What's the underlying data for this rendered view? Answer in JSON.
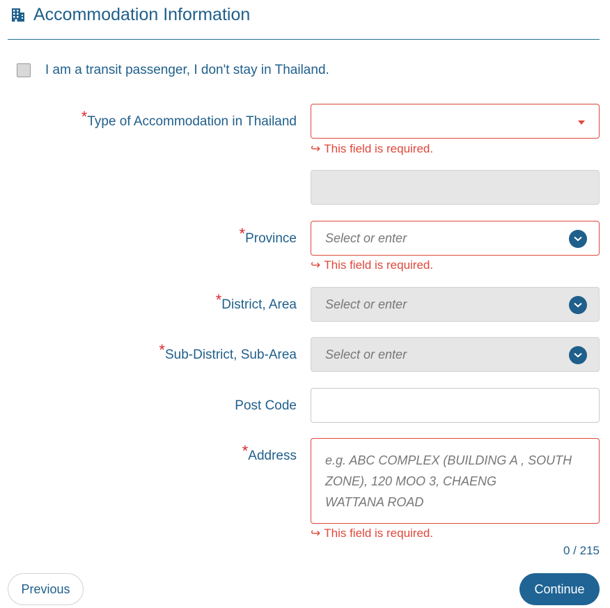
{
  "header": {
    "title": "Accommodation Information",
    "icon": "building-icon"
  },
  "transit": {
    "label": "I am a transit passenger, I don't stay in Thailand."
  },
  "accommodation_type": {
    "label": "Type of Accommodation in Thailand",
    "value": "",
    "error": "This field is required."
  },
  "province": {
    "label": "Province",
    "placeholder": "Select or enter",
    "error": "This field is required."
  },
  "district": {
    "label": "District, Area",
    "placeholder": "Select or enter"
  },
  "subdistrict": {
    "label": "Sub-District, Sub-Area",
    "placeholder": "Select or enter"
  },
  "postcode": {
    "label": "Post Code",
    "value": ""
  },
  "address": {
    "label": "Address",
    "placeholder_lines": [
      "e.g. ABC COMPLEX (BUILDING A , SOUTH",
      "ZONE), 120 MOO 3, CHAENG",
      "WATTANA ROAD"
    ],
    "error": "This field is required.",
    "counter": "0 / 215"
  },
  "buttons": {
    "previous": "Previous",
    "continue": "Continue"
  },
  "colors": {
    "primary": "#1f5f8b",
    "error": "#e0473a",
    "required": "#e0262d",
    "disabled_bg": "#e6e6e6"
  }
}
